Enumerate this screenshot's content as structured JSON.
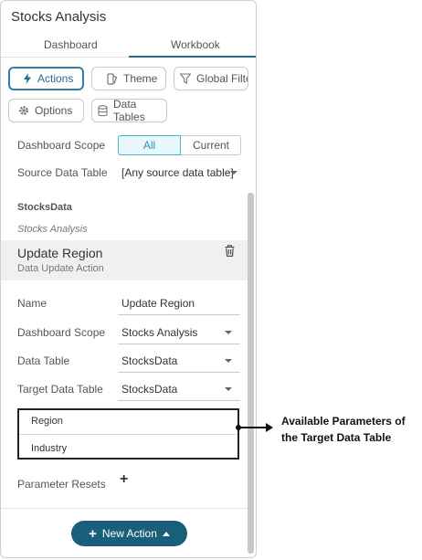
{
  "panel": {
    "title": "Stocks Analysis"
  },
  "tabs": {
    "dashboard": "Dashboard",
    "workbook": "Workbook",
    "active": "Workbook"
  },
  "toolbar": {
    "actions": "Actions",
    "theme": "Theme",
    "global_filter": "Global Filter",
    "options": "Options",
    "data_tables": "Data Tables"
  },
  "scope": {
    "label": "Dashboard Scope",
    "options": [
      "All",
      "Current"
    ],
    "selected": "All"
  },
  "source": {
    "label": "Source Data Table",
    "value": "[Any source data table]"
  },
  "group": {
    "table": "StocksData",
    "dashboard": "Stocks Analysis"
  },
  "action": {
    "name": "Update Region",
    "type": "Data Update Action"
  },
  "form": {
    "name_label": "Name",
    "name_value": "Update Region",
    "scope_label": "Dashboard Scope",
    "scope_value": "Stocks Analysis",
    "table_label": "Data Table",
    "table_value": "StocksData",
    "target_label": "Target Data Table",
    "target_value": "StocksData"
  },
  "parameters": [
    "Region",
    "Industry"
  ],
  "resets": {
    "label": "Parameter Resets"
  },
  "new_action": {
    "label": "New Action"
  },
  "annotation": {
    "line1": "Available Parameters of",
    "line2": "the Target Data Table"
  },
  "colors": {
    "accent": "#1f6d8c",
    "button": "#1a5f7a",
    "selected_bg": "#e9f6fb"
  }
}
